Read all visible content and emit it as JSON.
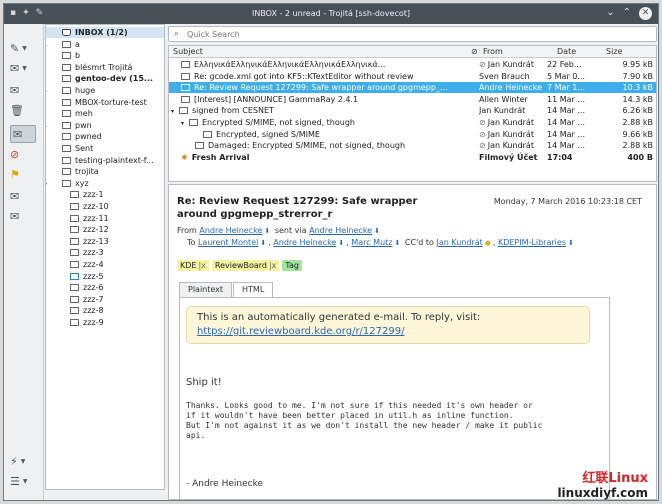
{
  "window": {
    "title": "INBOX - 2 unread - Trojitá [ssh-dovecot]"
  },
  "search": {
    "placeholder": "Quick Search"
  },
  "folders": [
    {
      "label": "INBOX (1/2)",
      "bold": true,
      "selected": true,
      "arrow": "",
      "indent": 18,
      "icon": "inbox"
    },
    {
      "label": "a",
      "arrow": "▸",
      "indent": 18
    },
    {
      "label": "b",
      "arrow": "",
      "indent": 18
    },
    {
      "label": "blésmrt Trojitá",
      "arrow": "",
      "indent": 18
    },
    {
      "label": "gentoo-dev (15...",
      "bold": true,
      "arrow": "",
      "indent": 18
    },
    {
      "label": "huge",
      "arrow": "▸",
      "indent": 18
    },
    {
      "label": "MBOX-torture-test",
      "arrow": "",
      "indent": 18
    },
    {
      "label": "meh",
      "arrow": "",
      "indent": 18
    },
    {
      "label": "pwn",
      "arrow": "▸",
      "indent": 18
    },
    {
      "label": "pwned",
      "arrow": "",
      "indent": 18
    },
    {
      "label": "Sent",
      "arrow": "",
      "indent": 18
    },
    {
      "label": "testing-plaintext-f...",
      "arrow": "",
      "indent": 18
    },
    {
      "label": "trojita",
      "arrow": "",
      "indent": 18
    },
    {
      "label": "xyz",
      "arrow": "▾",
      "indent": 18
    },
    {
      "label": "zzz-1",
      "arrow": "",
      "indent": 26
    },
    {
      "label": "zzz-10",
      "arrow": "",
      "indent": 26
    },
    {
      "label": "zzz-11",
      "arrow": "",
      "indent": 26
    },
    {
      "label": "zzz-12",
      "arrow": "",
      "indent": 26
    },
    {
      "label": "zzz-13",
      "arrow": "",
      "indent": 26
    },
    {
      "label": "zzz-3",
      "arrow": "",
      "indent": 26
    },
    {
      "label": "zzz-4",
      "arrow": "",
      "indent": 26
    },
    {
      "label": "zzz-5",
      "arrow": "",
      "indent": 26,
      "icon": "blue"
    },
    {
      "label": "zzz-6",
      "arrow": "",
      "indent": 26
    },
    {
      "label": "zzz-7",
      "arrow": "",
      "indent": 26
    },
    {
      "label": "zzz-8",
      "arrow": "",
      "indent": 26
    },
    {
      "label": "zzz-9",
      "arrow": "",
      "indent": 26
    }
  ],
  "msglist": {
    "headers": {
      "subject": "Subject",
      "from": "From",
      "date": "Date",
      "size": "Size"
    },
    "rows": [
      {
        "subject": "ΕλληνικάΕλληνικάΕλληνικάΕλληνικάΕλληνικά...",
        "from": "Jan Kundrát",
        "date": "22 Feb...",
        "size": "9.95 kB",
        "indent": 12,
        "icon": "mail",
        "att": true
      },
      {
        "subject": "Re: gcode.xml got into KF5::KTextEditor without review",
        "from": "Sven Brauch",
        "date": "5 Mar 0...",
        "size": "7.90 kB",
        "indent": 12,
        "icon": "mail"
      },
      {
        "subject": "Re: Review Request 127299: Safe wrapper around gpgmepp_...",
        "from": "Andre Heinecke",
        "date": "7 Mar 1...",
        "size": "10.3 kB",
        "indent": 12,
        "icon": "mail",
        "selected": true
      },
      {
        "subject": "[Interest] [ANNOUNCE] GammaRay 2.4.1",
        "from": "Allen Winter",
        "date": "11 Mar ...",
        "size": "14.3 kB",
        "indent": 12,
        "icon": "mail"
      },
      {
        "subject": "signed from CESNET",
        "from": "Jan Kundrát",
        "date": "14 Mar ...",
        "size": "6.26 kB",
        "indent": 2,
        "arrow": "▾",
        "icon": "mail"
      },
      {
        "subject": "Encrypted S/MIME, not signed, though",
        "from": "Jan Kundrát",
        "date": "14 Mar ...",
        "size": "2.88 kB",
        "indent": 12,
        "arrow": "▾",
        "icon": "mail",
        "att": true
      },
      {
        "subject": "Encrypted, signed S/MIME",
        "from": "Jan Kundrát",
        "date": "14 Mar ...",
        "size": "9.66 kB",
        "indent": 34,
        "icon": "mail",
        "att": true
      },
      {
        "subject": "Damaged: Encrypted S/MIME, not signed, though",
        "from": "Jan Kundrát",
        "date": "14 Mar ...",
        "size": "2.88 kB",
        "indent": 26,
        "icon": "mail",
        "att": true
      },
      {
        "subject": "Fresh Arrival",
        "from": "Filmový Účet",
        "date": "17:04",
        "size": "400 B",
        "indent": 12,
        "icon": "sun",
        "bold": true
      }
    ]
  },
  "preview": {
    "subject": "Re: Review Request 127299: Safe wrapper around gpgmepp_strerror_r",
    "date": "Monday, 7 March 2016 10:23:18 CET",
    "from_label": "From",
    "from_name": "Andre Heinecke",
    "sent_via": "sent via",
    "via_name": "Andre Heinecke",
    "to_label": "To",
    "to": [
      "Laurent Montel",
      "Andre Heinecke",
      "Marc Mutz"
    ],
    "cc_label": "CC'd to",
    "cc": [
      "Jan Kundrát",
      "KDEPIM-Libraries"
    ],
    "tags": [
      {
        "label": "KDE",
        "color": "#f6f3a0",
        "removable": true
      },
      {
        "label": "ReviewBoard",
        "color": "#f6f3a0",
        "removable": true
      },
      {
        "label": "Tag",
        "color": "#9ee59e",
        "removable": false
      }
    ],
    "tabs": [
      "Plaintext",
      "HTML"
    ],
    "notice_text": "This is an automatically generated e-mail. To reply, visit:",
    "notice_link": "https://git.reviewboard.kde.org/r/127299/",
    "shipit": "Ship it!",
    "body_text": "Thanks. Looks good to me. I'm not sure if this needed it's own header or\nif it wouldn't have been better placed in util.h as inline function.\nBut I'm not against it as we don't install the new header / make it public\napi.",
    "signature": "- Andre Heinecke"
  },
  "watermark": {
    "line1": "红联Linux",
    "line2": "linuxdiyf.com"
  }
}
